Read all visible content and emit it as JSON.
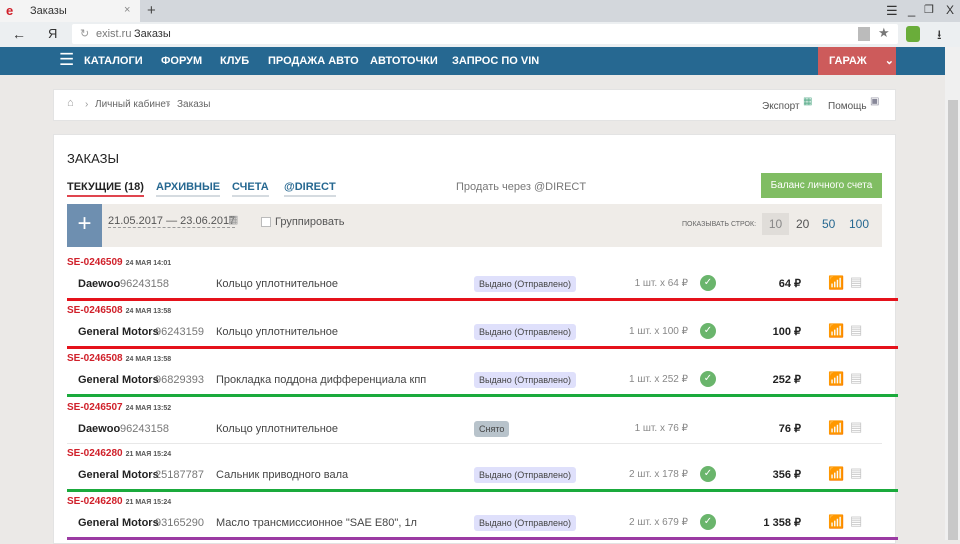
{
  "browser": {
    "tab_title": "Заказы",
    "url_domain": "exist.ru",
    "url_title": "Заказы"
  },
  "nav": {
    "items": [
      "КАТАЛОГИ",
      "ФОРУМ",
      "КЛУБ",
      "ПРОДАЖА АВТО",
      "АВТОТОЧКИ",
      "ЗАПРОС ПО VIN"
    ],
    "garage": "ГАРАЖ"
  },
  "breadcrumb": {
    "items": [
      "Личный кабинет",
      "Заказы"
    ],
    "export": "Экспорт",
    "help": "Помощь"
  },
  "orders": {
    "title": "ЗАКАЗЫ",
    "tabs": [
      "ТЕКУЩИЕ (18)",
      "АРХИВНЫЕ",
      "СЧЕТА",
      "@DIRECT"
    ],
    "sell_link": "Продать через @DIRECT",
    "balance_button": "Баланс личного счета",
    "date_range": "21.05.2017 — 23.06.2017",
    "group_label": "Группировать",
    "rows_label": "ПОКАЗЫВАТЬ СТРОК:",
    "rows_options": [
      "10",
      "20",
      "50",
      "100"
    ],
    "rows_selected": "10"
  },
  "rows": [
    {
      "order": "SE-0246509",
      "date": "24 МАЯ 14:01",
      "brand": "Daewoo",
      "part": "96243158",
      "name": "Кольцо уплотнительное",
      "status": "Выдано (Отправлено)",
      "qty": "1 шт. x 64 ₽",
      "check": true,
      "price": "64 ₽",
      "line": "#e5121b"
    },
    {
      "order": "SE-0246508",
      "date": "24 МАЯ 13:58",
      "brand": "General Motors",
      "part": "96243159",
      "name": "Кольцо уплотнительное",
      "status": "Выдано (Отправлено)",
      "qty": "1 шт. x 100 ₽",
      "check": true,
      "price": "100 ₽",
      "line": "#e5121b"
    },
    {
      "order": "SE-0246508",
      "date": "24 МАЯ 13:58",
      "brand": "General Motors",
      "part": "96829393",
      "name": "Прокладка поддона дифференциала кпп",
      "status": "Выдано (Отправлено)",
      "qty": "1 шт. x 252 ₽",
      "check": true,
      "price": "252 ₽",
      "line": "#1aaa3c"
    },
    {
      "order": "SE-0246507",
      "date": "24 МАЯ 13:52",
      "brand": "Daewoo",
      "part": "96243158",
      "name": "Кольцо уплотнительное",
      "status": "Снято",
      "qty": "1 шт. x 76 ₽",
      "check": false,
      "price": "76 ₽",
      "line": "#e8e8e8"
    },
    {
      "order": "SE-0246280",
      "date": "21 МАЯ 15:24",
      "brand": "General Motors",
      "part": "25187787",
      "name": "Сальник приводного вала",
      "status": "Выдано (Отправлено)",
      "qty": "2 шт. x 178 ₽",
      "check": true,
      "price": "356 ₽",
      "line": "#1aaa3c"
    },
    {
      "order": "SE-0246280",
      "date": "21 МАЯ 15:24",
      "brand": "General Motors",
      "part": "93165290",
      "name": "Масло трансмиссионное \"SAE E80\", 1л",
      "status": "Выдано (Отправлено)",
      "qty": "2 шт. x 679 ₽",
      "check": true,
      "price": "1 358 ₽",
      "line": "#9b3ba3"
    }
  ]
}
